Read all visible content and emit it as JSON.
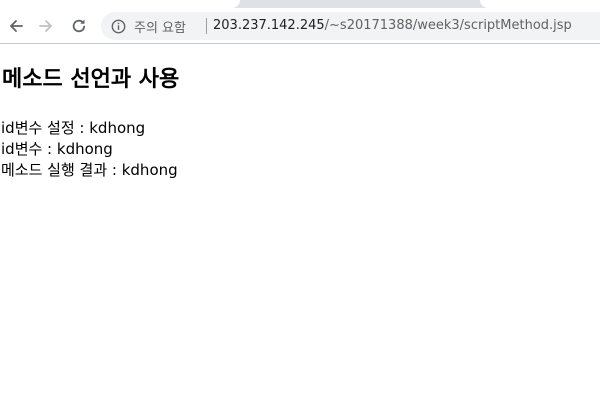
{
  "browser": {
    "security_label": "주의 요함",
    "url_host": "203.237.142.245",
    "url_path": "/~s20171388/week3/scriptMethod.jsp",
    "icons": {
      "back": "arrow-left-icon",
      "forward": "arrow-right-icon",
      "reload": "reload-icon",
      "info": "info-icon"
    }
  },
  "page": {
    "title": "메소드 선언과 사용",
    "lines": [
      "id변수 설정 : kdhong",
      "id변수 : kdhong",
      "메소드 실행 결과 : kdhong"
    ]
  }
}
